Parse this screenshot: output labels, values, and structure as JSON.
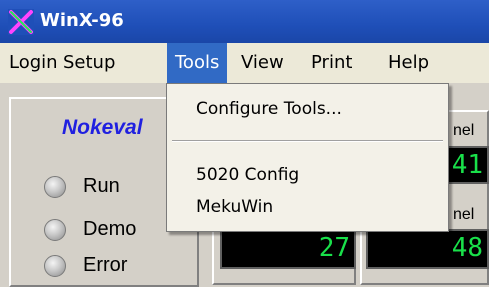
{
  "window": {
    "title": "WinX-96",
    "icon": "app-x-icon"
  },
  "menubar": {
    "items": [
      {
        "label": "Login"
      },
      {
        "label": "Setup"
      },
      {
        "label": "Tools",
        "active": true
      },
      {
        "label": "View"
      },
      {
        "label": "Print"
      },
      {
        "label": "Help"
      }
    ]
  },
  "dropdown": {
    "items": [
      {
        "label": "Configure Tools..."
      },
      {
        "label": "5020 Config"
      },
      {
        "label": "MekuWin"
      }
    ]
  },
  "panel": {
    "brand": "Nokeval",
    "indicators": [
      {
        "label": "Run"
      },
      {
        "label": "Demo"
      },
      {
        "label": "Error"
      }
    ]
  },
  "channels": [
    {
      "label": "nel",
      "value": "41"
    },
    {
      "label": "nel",
      "value": "48"
    },
    {
      "value": "27"
    }
  ],
  "colors": {
    "titlebar": "#1f4fb8",
    "menu_highlight": "#316ac5",
    "lcd_text": "#19e04a",
    "brand": "#2020e0"
  }
}
